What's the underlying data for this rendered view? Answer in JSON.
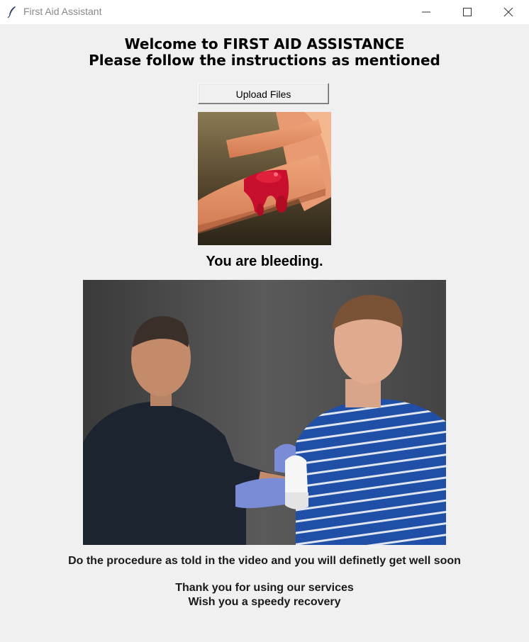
{
  "window": {
    "title": "First Aid Assistant",
    "controls": {
      "minimize": "minimize-icon",
      "maximize": "maximize-icon",
      "close": "close-icon"
    }
  },
  "header": {
    "line1": "Welcome to FIRST AID ASSISTANCE",
    "line2": "Please follow the instructions as mentioned"
  },
  "upload_button": {
    "label": "Upload Files"
  },
  "uploaded_image": {
    "subject": "bleeding finger"
  },
  "diagnosis": {
    "text": "You are bleeding."
  },
  "video": {
    "subject": "first aid bleeding bandage demonstration"
  },
  "instruction": {
    "text": "Do the procedure as told in the video and you will definetly get well soon"
  },
  "footer": {
    "line1": "Thank you for using our services",
    "line2": "Wish you a speedy recovery"
  },
  "colors": {
    "background": "#f0f0f0",
    "titlebar": "#ffffff",
    "blood": "#c8102e",
    "shirt_blue": "#1f4fa6"
  }
}
